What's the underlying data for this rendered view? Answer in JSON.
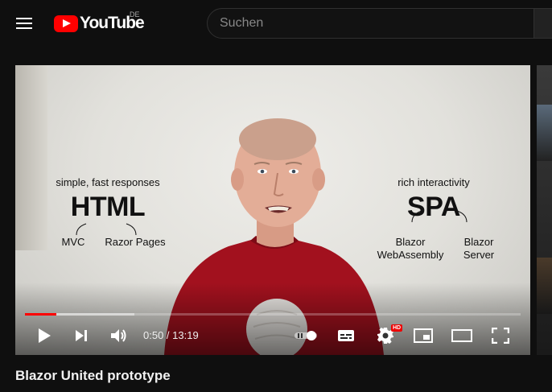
{
  "header": {
    "logo_text": "YouTube",
    "country_code": "DE",
    "search_placeholder": "Suchen"
  },
  "video": {
    "overlay": {
      "left_caption": "simple, fast responses",
      "left_big": "HTML",
      "left_item_1": "MVC",
      "left_item_2": "Razor Pages",
      "right_caption": "rich interactivity",
      "right_big": "SPA",
      "right_item_1": "Blazor\nWebAssembly",
      "right_item_2": "Blazor\nServer"
    },
    "progress_played": 0.063,
    "progress_loaded": 0.22
  },
  "controls": {
    "time_current": "0:50",
    "time_separator": " / ",
    "time_total": "13:19",
    "hd_label": "HD",
    "autoplay": "on"
  },
  "title": "Blazor United prototype",
  "colors": {
    "background": "#0f0f0f",
    "brand_red": "#ff0000",
    "text": "#f1f1f1"
  }
}
